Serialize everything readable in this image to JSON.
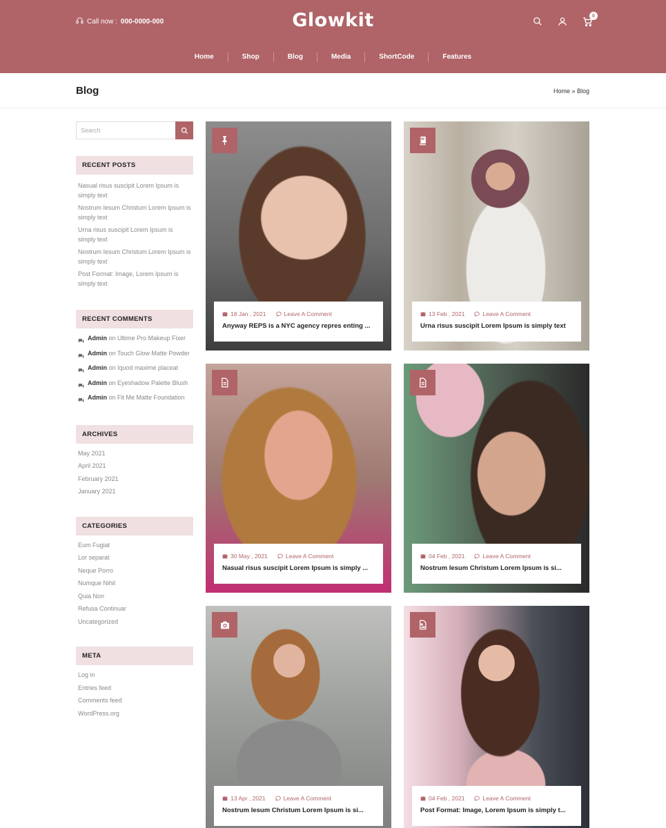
{
  "header": {
    "call_label": "Call now : ",
    "call_number": "000-0000-000",
    "logo": "Glowkit",
    "cart_count": "0",
    "nav": [
      "Home",
      "Shop",
      "Blog",
      "Media",
      "ShortCode",
      "Features"
    ]
  },
  "titlebar": {
    "title": "Blog",
    "breadcrumb": "Home » Blog"
  },
  "sidebar": {
    "search_placeholder": "Search",
    "recent_posts": {
      "heading": "RECENT POSTS",
      "items": [
        "Nasual risus suscipit Lorem Ipsum is simply text",
        "Nostrum Iesum Christum Lorem Ipsum is simply text",
        "Urna risus suscipit Lorem Ipsum is simply text",
        "Nostrum Iesum Christum Lorem Ipsum is simply text",
        "Post Format: Image, Lorem Ipsum is simply text"
      ]
    },
    "recent_comments": {
      "heading": "RECENT COMMENTS",
      "items": [
        {
          "author": "Admin",
          "on": " on ",
          "post": "Ultime Pro Makeup Fixer"
        },
        {
          "author": "Admin",
          "on": " on ",
          "post": "Touch Glow Matte Powder"
        },
        {
          "author": "Admin",
          "on": " on ",
          "post": "Iquod maxime placeat"
        },
        {
          "author": "Admin",
          "on": " on ",
          "post": "Eyeshadow Palette Blush"
        },
        {
          "author": "Admin",
          "on": " on ",
          "post": "Fit Me Matte Foundation"
        }
      ]
    },
    "archives": {
      "heading": "ARCHIVES",
      "items": [
        "May 2021",
        "April 2021",
        "February 2021",
        "January 2021"
      ]
    },
    "categories": {
      "heading": "CATEGORIES",
      "items": [
        "Eum Fugiat",
        "Lor separat",
        "Neque Porro",
        "Numque Nihil",
        "Quia Non",
        "Refusa Continuar",
        "Uncategorized"
      ]
    },
    "meta": {
      "heading": "META",
      "items": [
        "Log in",
        "Entries feed",
        "Comments feed",
        "WordPress.org"
      ]
    }
  },
  "posts": [
    {
      "format_icon": "pin-icon",
      "date": "18 Jan , 2021",
      "comment": "Leave A Comment",
      "title": "Anyway REPS is a NYC agency repres enting ..."
    },
    {
      "format_icon": "book-icon",
      "date": "13 Feb , 2021",
      "comment": "Leave A Comment",
      "title": "Urna risus suscipit Lorem Ipsum is simply text"
    },
    {
      "format_icon": "document-icon",
      "date": "30 May , 2021",
      "comment": "Leave A Comment",
      "title": "Nasual risus suscipit Lorem Ipsum is simply ..."
    },
    {
      "format_icon": "document-icon",
      "date": "04 Feb , 2021",
      "comment": "Leave A Comment",
      "title": "Nostrum Iesum Christum Lorem Ipsum is si..."
    },
    {
      "format_icon": "camera-icon",
      "date": "13 Apr , 2021",
      "comment": "Leave A Comment",
      "title": "Nostrum Iesum Christum Lorem Ipsum is si..."
    },
    {
      "format_icon": "image-icon",
      "date": "04 Feb , 2021",
      "comment": "Leave A Comment",
      "title": "Post Format: Image, Lorem Ipsum is simply t..."
    }
  ],
  "colors": {
    "brand": "#b06468",
    "widget_head_bg": "#f0e0e1"
  }
}
